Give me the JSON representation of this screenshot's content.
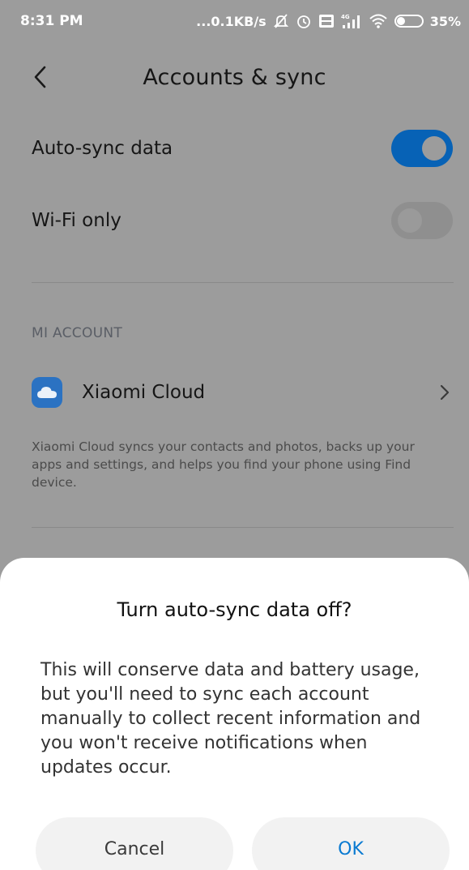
{
  "status_bar": {
    "time": "8:31 PM",
    "network_speed": "...0.1KB/s",
    "battery": "35%",
    "battery_level": 0.35,
    "icons": [
      "mute-icon",
      "alarm-icon",
      "volte-icon",
      "4g-signal-icon",
      "wifi-icon",
      "battery-icon"
    ]
  },
  "header": {
    "title": "Accounts & sync",
    "back_icon": "chevron-left-icon"
  },
  "settings": {
    "auto_sync": {
      "label": "Auto-sync data",
      "enabled": true
    },
    "wifi_only": {
      "label": "Wi-Fi only",
      "enabled": false
    }
  },
  "mi_account": {
    "section_title": "MI ACCOUNT",
    "cloud_label": "Xiaomi Cloud",
    "cloud_description": "Xiaomi Cloud syncs your contacts and photos, backs up your apps and settings, and helps you find your phone using Find device."
  },
  "dialog": {
    "title": "Turn auto-sync data off?",
    "message": "This will conserve data and battery usage, but you'll need to sync each account manually to collect recent information and you won't receive notifications when updates occur.",
    "cancel_label": "Cancel",
    "ok_label": "OK"
  },
  "colors": {
    "accent": "#0a7ad1",
    "toggle_on": "#0762b6",
    "cloud_icon": "#2b72c2",
    "scrim": "#9c9c9c"
  }
}
